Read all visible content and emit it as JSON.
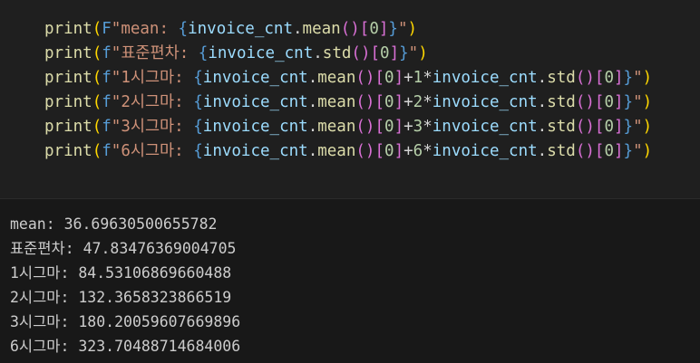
{
  "code": {
    "lines": [
      {
        "tokens": [
          {
            "text": "print",
            "cls": "fn"
          },
          {
            "text": "(",
            "cls": "p1"
          },
          {
            "text": "F",
            "cls": "sp"
          },
          {
            "text": "\"mean: ",
            "cls": "st"
          },
          {
            "text": "{",
            "cls": "sp"
          },
          {
            "text": "invoice_cnt",
            "cls": "vr"
          },
          {
            "text": ".",
            "cls": "op"
          },
          {
            "text": "mean",
            "cls": "fn"
          },
          {
            "text": "()",
            "cls": "p2"
          },
          {
            "text": "[",
            "cls": "p2"
          },
          {
            "text": "0",
            "cls": "nu"
          },
          {
            "text": "]",
            "cls": "p2"
          },
          {
            "text": "}",
            "cls": "sp"
          },
          {
            "text": "\"",
            "cls": "st"
          },
          {
            "text": ")",
            "cls": "p1"
          }
        ]
      },
      {
        "tokens": [
          {
            "text": "print",
            "cls": "fn"
          },
          {
            "text": "(",
            "cls": "p1"
          },
          {
            "text": "f",
            "cls": "sp"
          },
          {
            "text": "\"표준편차: ",
            "cls": "st"
          },
          {
            "text": "{",
            "cls": "sp"
          },
          {
            "text": "invoice_cnt",
            "cls": "vr"
          },
          {
            "text": ".",
            "cls": "op"
          },
          {
            "text": "std",
            "cls": "fn"
          },
          {
            "text": "()",
            "cls": "p2"
          },
          {
            "text": "[",
            "cls": "p2"
          },
          {
            "text": "0",
            "cls": "nu"
          },
          {
            "text": "]",
            "cls": "p2"
          },
          {
            "text": "}",
            "cls": "sp"
          },
          {
            "text": "\"",
            "cls": "st"
          },
          {
            "text": ")",
            "cls": "p1"
          }
        ]
      },
      {
        "tokens": [
          {
            "text": "print",
            "cls": "fn"
          },
          {
            "text": "(",
            "cls": "p1"
          },
          {
            "text": "f",
            "cls": "sp"
          },
          {
            "text": "\"1시그마: ",
            "cls": "st"
          },
          {
            "text": "{",
            "cls": "sp"
          },
          {
            "text": "invoice_cnt",
            "cls": "vr"
          },
          {
            "text": ".",
            "cls": "op"
          },
          {
            "text": "mean",
            "cls": "fn"
          },
          {
            "text": "()",
            "cls": "p2"
          },
          {
            "text": "[",
            "cls": "p2"
          },
          {
            "text": "0",
            "cls": "nu"
          },
          {
            "text": "]",
            "cls": "p2"
          },
          {
            "text": "+",
            "cls": "op"
          },
          {
            "text": "1",
            "cls": "nu"
          },
          {
            "text": "*",
            "cls": "op"
          },
          {
            "text": "invoice_cnt",
            "cls": "vr"
          },
          {
            "text": ".",
            "cls": "op"
          },
          {
            "text": "std",
            "cls": "fn"
          },
          {
            "text": "()",
            "cls": "p2"
          },
          {
            "text": "[",
            "cls": "p2"
          },
          {
            "text": "0",
            "cls": "nu"
          },
          {
            "text": "]",
            "cls": "p2"
          },
          {
            "text": "}",
            "cls": "sp"
          },
          {
            "text": "\"",
            "cls": "st"
          },
          {
            "text": ")",
            "cls": "p1"
          }
        ]
      },
      {
        "tokens": [
          {
            "text": "print",
            "cls": "fn"
          },
          {
            "text": "(",
            "cls": "p1"
          },
          {
            "text": "f",
            "cls": "sp"
          },
          {
            "text": "\"2시그마: ",
            "cls": "st"
          },
          {
            "text": "{",
            "cls": "sp"
          },
          {
            "text": "invoice_cnt",
            "cls": "vr"
          },
          {
            "text": ".",
            "cls": "op"
          },
          {
            "text": "mean",
            "cls": "fn"
          },
          {
            "text": "()",
            "cls": "p2"
          },
          {
            "text": "[",
            "cls": "p2"
          },
          {
            "text": "0",
            "cls": "nu"
          },
          {
            "text": "]",
            "cls": "p2"
          },
          {
            "text": "+",
            "cls": "op"
          },
          {
            "text": "2",
            "cls": "nu"
          },
          {
            "text": "*",
            "cls": "op"
          },
          {
            "text": "invoice_cnt",
            "cls": "vr"
          },
          {
            "text": ".",
            "cls": "op"
          },
          {
            "text": "std",
            "cls": "fn"
          },
          {
            "text": "()",
            "cls": "p2"
          },
          {
            "text": "[",
            "cls": "p2"
          },
          {
            "text": "0",
            "cls": "nu"
          },
          {
            "text": "]",
            "cls": "p2"
          },
          {
            "text": "}",
            "cls": "sp"
          },
          {
            "text": "\"",
            "cls": "st"
          },
          {
            "text": ")",
            "cls": "p1"
          }
        ]
      },
      {
        "tokens": [
          {
            "text": "print",
            "cls": "fn"
          },
          {
            "text": "(",
            "cls": "p1"
          },
          {
            "text": "f",
            "cls": "sp"
          },
          {
            "text": "\"3시그마: ",
            "cls": "st"
          },
          {
            "text": "{",
            "cls": "sp"
          },
          {
            "text": "invoice_cnt",
            "cls": "vr"
          },
          {
            "text": ".",
            "cls": "op"
          },
          {
            "text": "mean",
            "cls": "fn"
          },
          {
            "text": "()",
            "cls": "p2"
          },
          {
            "text": "[",
            "cls": "p2"
          },
          {
            "text": "0",
            "cls": "nu"
          },
          {
            "text": "]",
            "cls": "p2"
          },
          {
            "text": "+",
            "cls": "op"
          },
          {
            "text": "3",
            "cls": "nu"
          },
          {
            "text": "*",
            "cls": "op"
          },
          {
            "text": "invoice_cnt",
            "cls": "vr"
          },
          {
            "text": ".",
            "cls": "op"
          },
          {
            "text": "std",
            "cls": "fn"
          },
          {
            "text": "()",
            "cls": "p2"
          },
          {
            "text": "[",
            "cls": "p2"
          },
          {
            "text": "0",
            "cls": "nu"
          },
          {
            "text": "]",
            "cls": "p2"
          },
          {
            "text": "}",
            "cls": "sp"
          },
          {
            "text": "\"",
            "cls": "st"
          },
          {
            "text": ")",
            "cls": "p1"
          }
        ]
      },
      {
        "tokens": [
          {
            "text": "print",
            "cls": "fn"
          },
          {
            "text": "(",
            "cls": "p1"
          },
          {
            "text": "f",
            "cls": "sp"
          },
          {
            "text": "\"6시그마: ",
            "cls": "st"
          },
          {
            "text": "{",
            "cls": "sp"
          },
          {
            "text": "invoice_cnt",
            "cls": "vr"
          },
          {
            "text": ".",
            "cls": "op"
          },
          {
            "text": "mean",
            "cls": "fn"
          },
          {
            "text": "()",
            "cls": "p2"
          },
          {
            "text": "[",
            "cls": "p2"
          },
          {
            "text": "0",
            "cls": "nu"
          },
          {
            "text": "]",
            "cls": "p2"
          },
          {
            "text": "+",
            "cls": "op"
          },
          {
            "text": "6",
            "cls": "nu"
          },
          {
            "text": "*",
            "cls": "op"
          },
          {
            "text": "invoice_cnt",
            "cls": "vr"
          },
          {
            "text": ".",
            "cls": "op"
          },
          {
            "text": "std",
            "cls": "fn"
          },
          {
            "text": "()",
            "cls": "p2"
          },
          {
            "text": "[",
            "cls": "p2"
          },
          {
            "text": "0",
            "cls": "nu"
          },
          {
            "text": "]",
            "cls": "p2"
          },
          {
            "text": "}",
            "cls": "sp"
          },
          {
            "text": "\"",
            "cls": "st"
          },
          {
            "text": ")",
            "cls": "p1"
          }
        ]
      }
    ]
  },
  "output": {
    "lines": [
      "mean: 36.69630500655782",
      "표준편차: 47.83476369004705",
      "1시그마: 84.53106869660488",
      "2시그마: 132.3658323866519",
      "3시그마: 180.20059607669896",
      "6시그마: 323.70488714684006"
    ]
  }
}
